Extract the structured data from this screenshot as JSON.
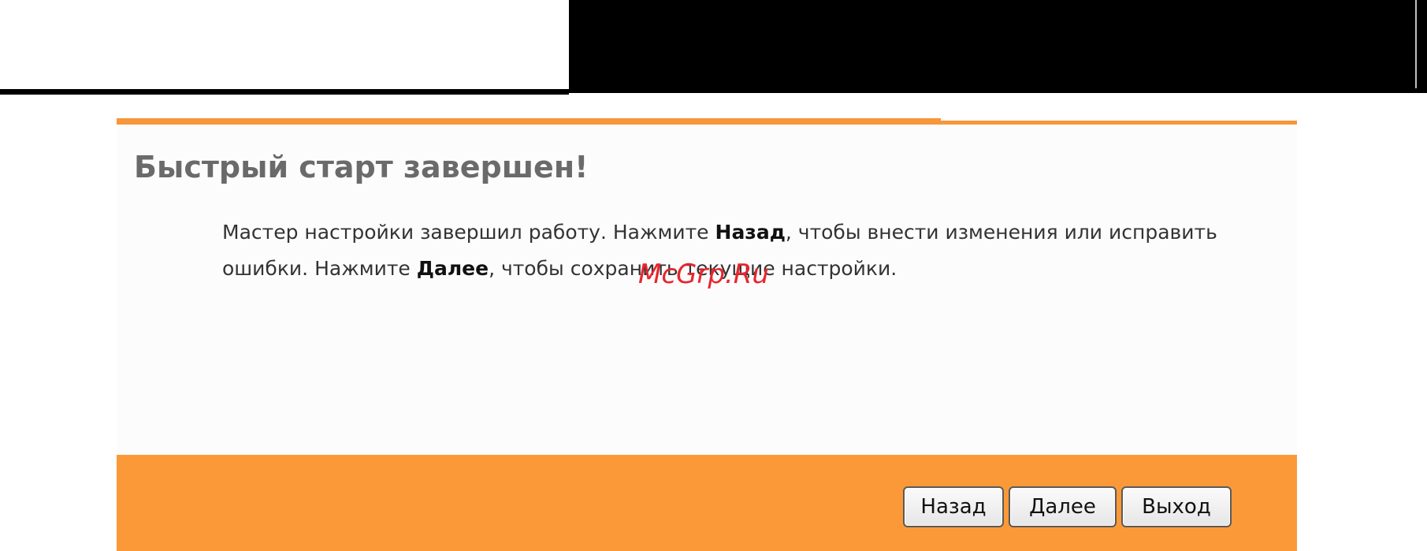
{
  "wizard": {
    "title": "Быстрый старт завершен!",
    "message": {
      "part1": "Мастер настройки завершил работу. Нажмите ",
      "back_emphasis": "Назад",
      "part2": ", чтобы внести изменения или исправить ошибки. Нажмите ",
      "next_emphasis": "Далее",
      "part3": ", чтобы сохранить текущие настройки."
    },
    "buttons": {
      "back_label": "Назад",
      "next_label": "Далее",
      "exit_label": "Выход"
    }
  },
  "watermark": "McGrp.Ru",
  "colors": {
    "accent_orange": "#fb9938",
    "title_gray": "#6a6a6a",
    "watermark_red": "#e8262e"
  }
}
